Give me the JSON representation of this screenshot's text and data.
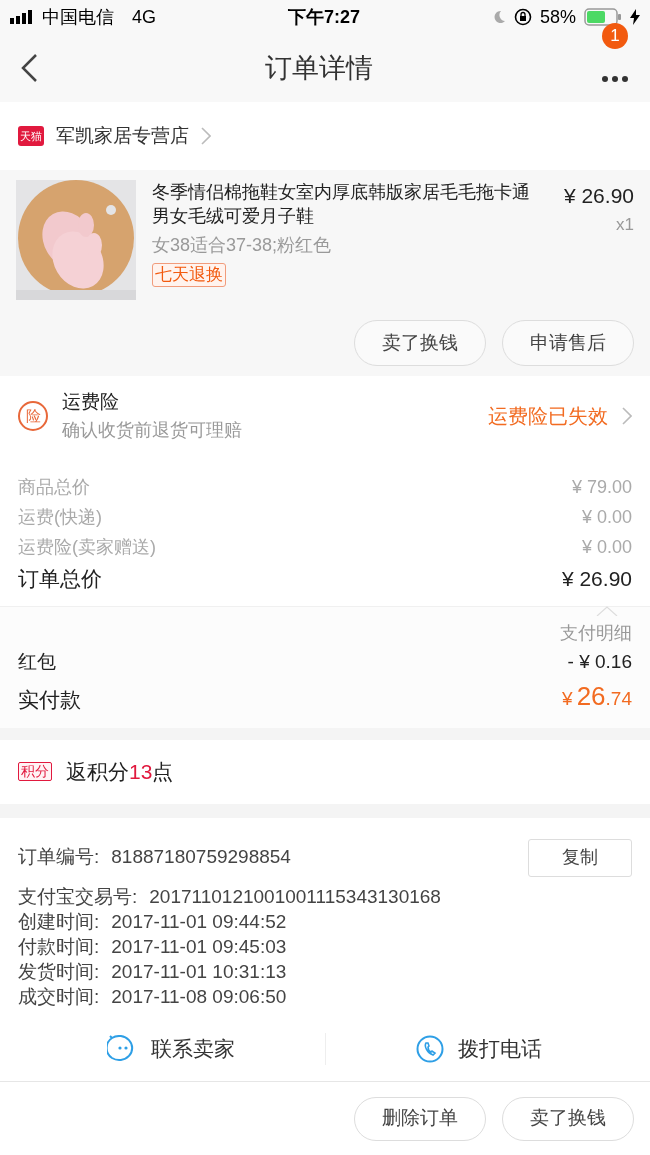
{
  "status_bar": {
    "carrier": "中国电信",
    "network": "4G",
    "time": "下午7:27",
    "battery": "58%"
  },
  "nav": {
    "title": "订单详情",
    "badge": "1"
  },
  "shop": {
    "name": "军凯家居专营店",
    "logo": "天猫"
  },
  "product": {
    "title": "冬季情侣棉拖鞋女室内厚底韩版家居毛毛拖卡通男女毛绒可爱月子鞋",
    "sku": "女38适合37-38;粉红色",
    "tag": "七天退换",
    "price": "¥ 26.90",
    "quantity": "x1",
    "actions": [
      "卖了换钱",
      "申请售后"
    ]
  },
  "insurance": {
    "icon": "险",
    "title": "运费险",
    "subtitle": "确认收货前退货可理赔",
    "status": "运费险已失效"
  },
  "price_lines": [
    {
      "label": "商品总价",
      "value": "¥ 79.00",
      "kind": "minor"
    },
    {
      "label": "运费(快递)",
      "value": "¥ 0.00",
      "kind": "minor"
    },
    {
      "label": "运费险(卖家赠送)",
      "value": "¥ 0.00",
      "kind": "minor"
    },
    {
      "label": "订单总价",
      "value": "¥ 26.90",
      "kind": "major"
    }
  ],
  "payment": {
    "detail_label": "支付明细",
    "lines": [
      {
        "label": "红包",
        "value": "- ¥ 0.16"
      }
    ],
    "paid_label": "实付款",
    "paid_symbol": "¥",
    "paid_int": "26",
    "paid_dec": ".74"
  },
  "points": {
    "tag": "积分",
    "prefix": "返积分",
    "count": "13",
    "suffix": "点"
  },
  "order_info": {
    "copy_button": "复制",
    "lines": [
      {
        "label": "订单编号:",
        "value": "81887180759298854"
      },
      {
        "label": "支付宝交易号:",
        "value": "2017110121001001115343130168"
      },
      {
        "label": "创建时间:",
        "value": "2017-11-01 09:44:52"
      },
      {
        "label": "付款时间:",
        "value": "2017-11-01 09:45:03"
      },
      {
        "label": "发货时间:",
        "value": "2017-11-01 10:31:13"
      },
      {
        "label": "成交时间:",
        "value": "2017-11-08 09:06:50"
      }
    ]
  },
  "contact": [
    {
      "label": "联系卖家",
      "kind": "chat"
    },
    {
      "label": "拨打电话",
      "kind": "phone"
    }
  ],
  "bottom_actions": [
    "删除订单",
    "卖了换钱"
  ]
}
